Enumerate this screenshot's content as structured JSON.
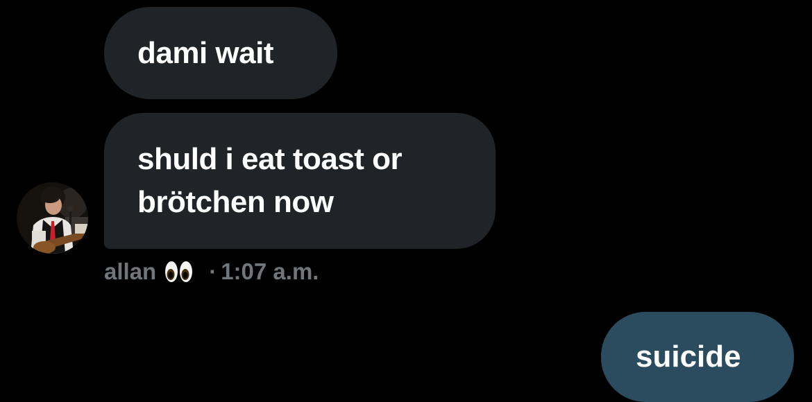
{
  "conversation": {
    "messages_in": [
      {
        "text": "dami wait"
      },
      {
        "lines": [
          "shuld i eat toast or",
          "brötchen now"
        ]
      }
    ],
    "meta": {
      "sender": "allan",
      "sender_emoji": "eyes-icon",
      "separator": "·",
      "time": "1:07 a.m."
    },
    "message_out": {
      "text": "suicide"
    },
    "colors": {
      "background": "#000000",
      "bubble_in": "#202327",
      "bubble_out": "#2b4c5f",
      "meta_text": "#71767b"
    }
  }
}
